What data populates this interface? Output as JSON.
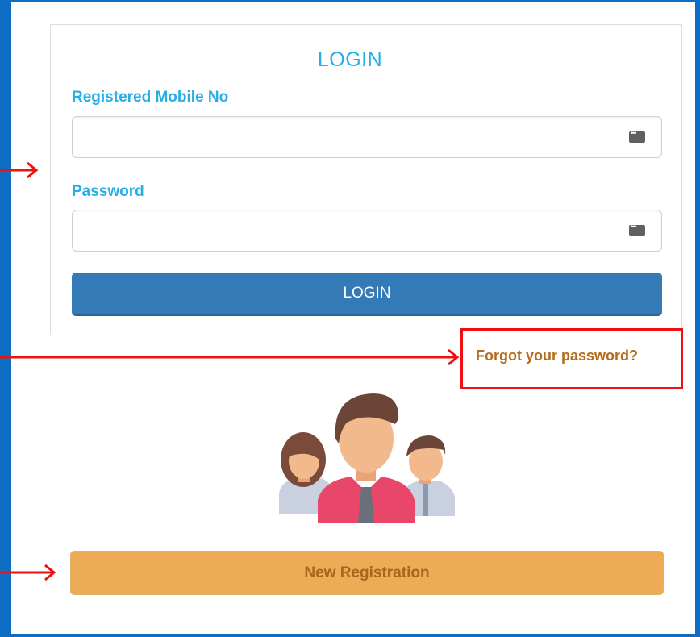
{
  "login_form": {
    "title": "LOGIN",
    "mobile_label": "Registered Mobile No",
    "mobile_value": "",
    "password_label": "Password",
    "password_value": "",
    "login_button": "LOGIN"
  },
  "forgot_link": "Forgot your password?",
  "register_button": "New Registration",
  "icons": {
    "field_autofill": "password-manager-key-icon",
    "illustration": "family-group-icon",
    "annotation": "red-arrow-icon"
  },
  "colors": {
    "frame": "#0d6ec4",
    "title": "#27aee6",
    "login_button": "#337ab7",
    "register_button": "#ecab54",
    "forgot_link": "#b56b1a",
    "annotation": "#ee1111"
  }
}
